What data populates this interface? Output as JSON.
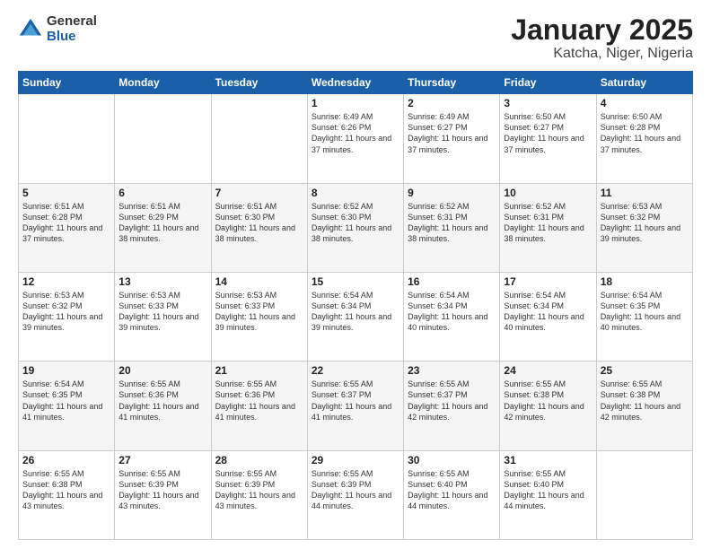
{
  "logo": {
    "general": "General",
    "blue": "Blue"
  },
  "header": {
    "title": "January 2025",
    "subtitle": "Katcha, Niger, Nigeria"
  },
  "weekdays": [
    "Sunday",
    "Monday",
    "Tuesday",
    "Wednesday",
    "Thursday",
    "Friday",
    "Saturday"
  ],
  "weeks": [
    [
      {
        "day": "",
        "sunrise": "",
        "sunset": "",
        "daylight": ""
      },
      {
        "day": "",
        "sunrise": "",
        "sunset": "",
        "daylight": ""
      },
      {
        "day": "",
        "sunrise": "",
        "sunset": "",
        "daylight": ""
      },
      {
        "day": "1",
        "sunrise": "Sunrise: 6:49 AM",
        "sunset": "Sunset: 6:26 PM",
        "daylight": "Daylight: 11 hours and 37 minutes."
      },
      {
        "day": "2",
        "sunrise": "Sunrise: 6:49 AM",
        "sunset": "Sunset: 6:27 PM",
        "daylight": "Daylight: 11 hours and 37 minutes."
      },
      {
        "day": "3",
        "sunrise": "Sunrise: 6:50 AM",
        "sunset": "Sunset: 6:27 PM",
        "daylight": "Daylight: 11 hours and 37 minutes."
      },
      {
        "day": "4",
        "sunrise": "Sunrise: 6:50 AM",
        "sunset": "Sunset: 6:28 PM",
        "daylight": "Daylight: 11 hours and 37 minutes."
      }
    ],
    [
      {
        "day": "5",
        "sunrise": "Sunrise: 6:51 AM",
        "sunset": "Sunset: 6:28 PM",
        "daylight": "Daylight: 11 hours and 37 minutes."
      },
      {
        "day": "6",
        "sunrise": "Sunrise: 6:51 AM",
        "sunset": "Sunset: 6:29 PM",
        "daylight": "Daylight: 11 hours and 38 minutes."
      },
      {
        "day": "7",
        "sunrise": "Sunrise: 6:51 AM",
        "sunset": "Sunset: 6:30 PM",
        "daylight": "Daylight: 11 hours and 38 minutes."
      },
      {
        "day": "8",
        "sunrise": "Sunrise: 6:52 AM",
        "sunset": "Sunset: 6:30 PM",
        "daylight": "Daylight: 11 hours and 38 minutes."
      },
      {
        "day": "9",
        "sunrise": "Sunrise: 6:52 AM",
        "sunset": "Sunset: 6:31 PM",
        "daylight": "Daylight: 11 hours and 38 minutes."
      },
      {
        "day": "10",
        "sunrise": "Sunrise: 6:52 AM",
        "sunset": "Sunset: 6:31 PM",
        "daylight": "Daylight: 11 hours and 38 minutes."
      },
      {
        "day": "11",
        "sunrise": "Sunrise: 6:53 AM",
        "sunset": "Sunset: 6:32 PM",
        "daylight": "Daylight: 11 hours and 39 minutes."
      }
    ],
    [
      {
        "day": "12",
        "sunrise": "Sunrise: 6:53 AM",
        "sunset": "Sunset: 6:32 PM",
        "daylight": "Daylight: 11 hours and 39 minutes."
      },
      {
        "day": "13",
        "sunrise": "Sunrise: 6:53 AM",
        "sunset": "Sunset: 6:33 PM",
        "daylight": "Daylight: 11 hours and 39 minutes."
      },
      {
        "day": "14",
        "sunrise": "Sunrise: 6:53 AM",
        "sunset": "Sunset: 6:33 PM",
        "daylight": "Daylight: 11 hours and 39 minutes."
      },
      {
        "day": "15",
        "sunrise": "Sunrise: 6:54 AM",
        "sunset": "Sunset: 6:34 PM",
        "daylight": "Daylight: 11 hours and 39 minutes."
      },
      {
        "day": "16",
        "sunrise": "Sunrise: 6:54 AM",
        "sunset": "Sunset: 6:34 PM",
        "daylight": "Daylight: 11 hours and 40 minutes."
      },
      {
        "day": "17",
        "sunrise": "Sunrise: 6:54 AM",
        "sunset": "Sunset: 6:34 PM",
        "daylight": "Daylight: 11 hours and 40 minutes."
      },
      {
        "day": "18",
        "sunrise": "Sunrise: 6:54 AM",
        "sunset": "Sunset: 6:35 PM",
        "daylight": "Daylight: 11 hours and 40 minutes."
      }
    ],
    [
      {
        "day": "19",
        "sunrise": "Sunrise: 6:54 AM",
        "sunset": "Sunset: 6:35 PM",
        "daylight": "Daylight: 11 hours and 41 minutes."
      },
      {
        "day": "20",
        "sunrise": "Sunrise: 6:55 AM",
        "sunset": "Sunset: 6:36 PM",
        "daylight": "Daylight: 11 hours and 41 minutes."
      },
      {
        "day": "21",
        "sunrise": "Sunrise: 6:55 AM",
        "sunset": "Sunset: 6:36 PM",
        "daylight": "Daylight: 11 hours and 41 minutes."
      },
      {
        "day": "22",
        "sunrise": "Sunrise: 6:55 AM",
        "sunset": "Sunset: 6:37 PM",
        "daylight": "Daylight: 11 hours and 41 minutes."
      },
      {
        "day": "23",
        "sunrise": "Sunrise: 6:55 AM",
        "sunset": "Sunset: 6:37 PM",
        "daylight": "Daylight: 11 hours and 42 minutes."
      },
      {
        "day": "24",
        "sunrise": "Sunrise: 6:55 AM",
        "sunset": "Sunset: 6:38 PM",
        "daylight": "Daylight: 11 hours and 42 minutes."
      },
      {
        "day": "25",
        "sunrise": "Sunrise: 6:55 AM",
        "sunset": "Sunset: 6:38 PM",
        "daylight": "Daylight: 11 hours and 42 minutes."
      }
    ],
    [
      {
        "day": "26",
        "sunrise": "Sunrise: 6:55 AM",
        "sunset": "Sunset: 6:38 PM",
        "daylight": "Daylight: 11 hours and 43 minutes."
      },
      {
        "day": "27",
        "sunrise": "Sunrise: 6:55 AM",
        "sunset": "Sunset: 6:39 PM",
        "daylight": "Daylight: 11 hours and 43 minutes."
      },
      {
        "day": "28",
        "sunrise": "Sunrise: 6:55 AM",
        "sunset": "Sunset: 6:39 PM",
        "daylight": "Daylight: 11 hours and 43 minutes."
      },
      {
        "day": "29",
        "sunrise": "Sunrise: 6:55 AM",
        "sunset": "Sunset: 6:39 PM",
        "daylight": "Daylight: 11 hours and 44 minutes."
      },
      {
        "day": "30",
        "sunrise": "Sunrise: 6:55 AM",
        "sunset": "Sunset: 6:40 PM",
        "daylight": "Daylight: 11 hours and 44 minutes."
      },
      {
        "day": "31",
        "sunrise": "Sunrise: 6:55 AM",
        "sunset": "Sunset: 6:40 PM",
        "daylight": "Daylight: 11 hours and 44 minutes."
      },
      {
        "day": "",
        "sunrise": "",
        "sunset": "",
        "daylight": ""
      }
    ]
  ]
}
